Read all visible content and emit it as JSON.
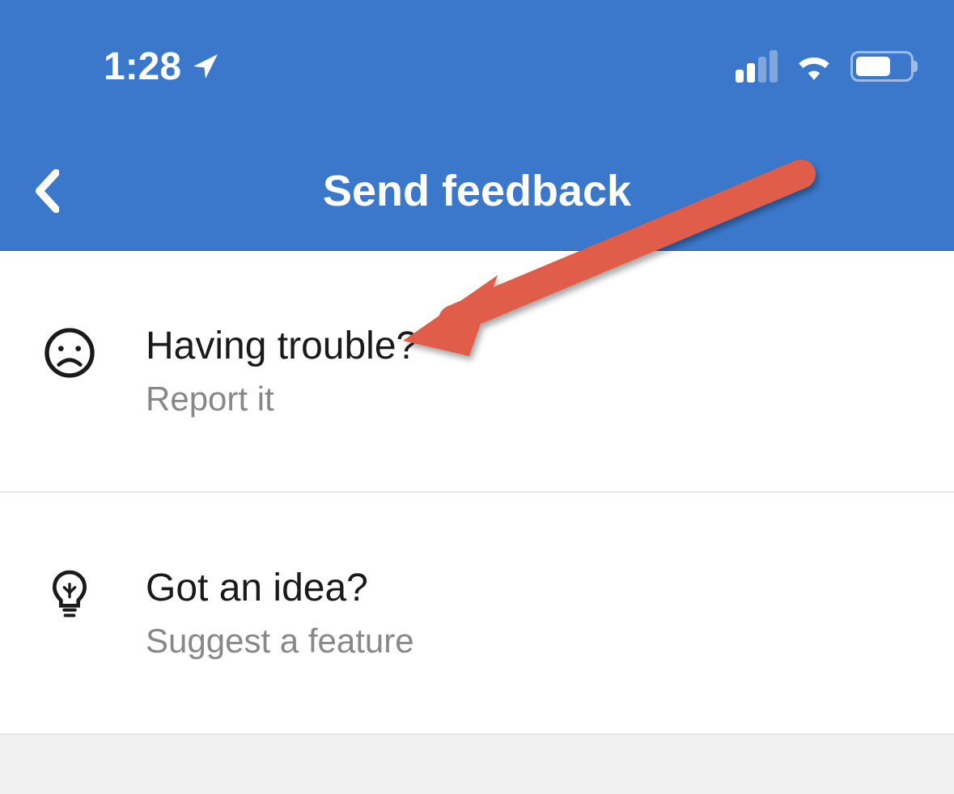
{
  "status_bar": {
    "time": "1:28"
  },
  "header": {
    "title": "Send feedback"
  },
  "options": [
    {
      "title": "Having trouble?",
      "subtitle": "Report it"
    },
    {
      "title": "Got an idea?",
      "subtitle": "Suggest a feature"
    }
  ]
}
